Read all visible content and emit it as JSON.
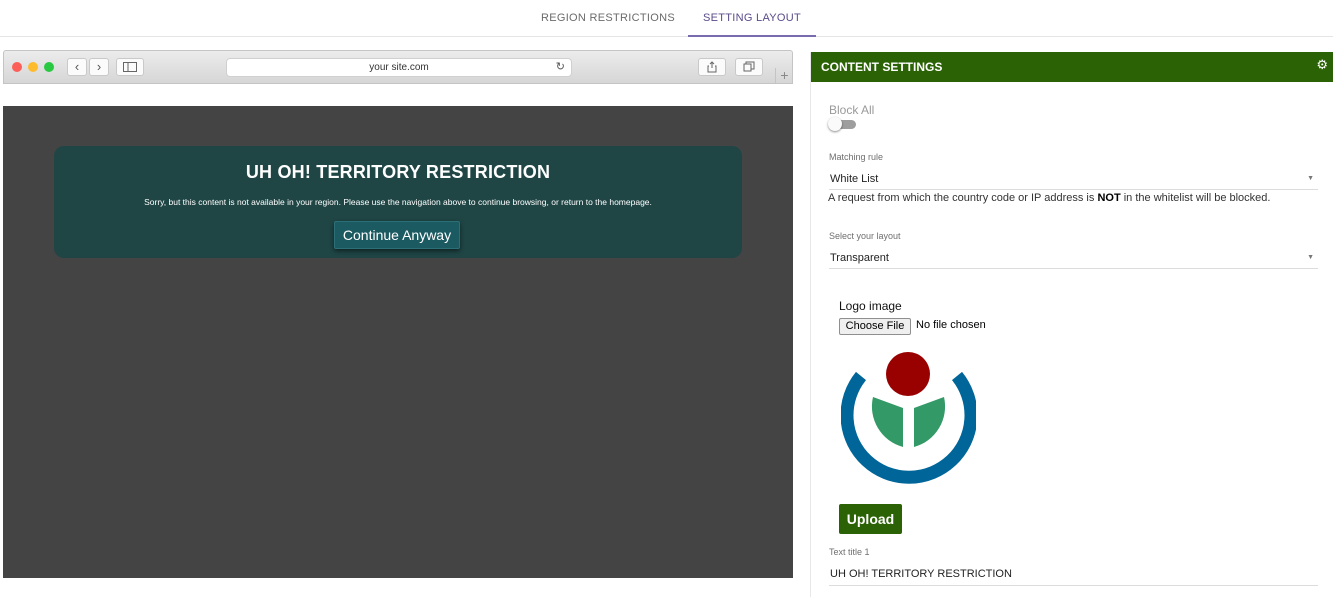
{
  "tabs": [
    {
      "label": "REGION RESTRICTIONS",
      "active": false
    },
    {
      "label": "SETTING LAYOUT",
      "active": true
    }
  ],
  "preview": {
    "url": "your site.com",
    "notice_title": "UH OH! TERRITORY RESTRICTION",
    "notice_message": "Sorry, but this content is not available in your region. Please use the navigation above to continue browsing, or return to the homepage.",
    "continue_label": "Continue Anyway"
  },
  "panel": {
    "title": "CONTENT SETTINGS",
    "block_all_label": "Block All",
    "block_all_enabled": false,
    "matching_rule_label": "Matching rule",
    "matching_rule_value": "White List",
    "hint_prefix": "A request from which the country code or IP address is ",
    "hint_bold": "NOT",
    "hint_suffix": " in the whitelist will be blocked.",
    "layout_label": "Select your layout",
    "layout_value": "Transparent",
    "logo_label": "Logo image",
    "choose_file_label": "Choose File",
    "no_file_text": "No file chosen",
    "upload_label": "Upload",
    "text_title_label": "Text title 1",
    "text_title_value": "UH OH! TERRITORY RESTRICTION"
  },
  "colors": {
    "accent_green": "#2b6206",
    "notice_bg": "#1f4545",
    "viewport_bg": "#444444",
    "tab_active": "#5a4b8a"
  }
}
